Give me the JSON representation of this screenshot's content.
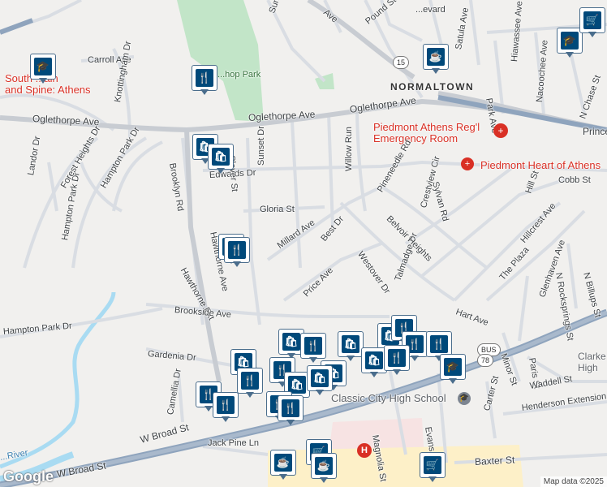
{
  "colors": {
    "water": "#a9dbf2",
    "park": "#c2e5c8",
    "highway": "#8fa4bd",
    "road": "#ffffff",
    "minor_road": "#d9dde3",
    "pin_border": "#4a6d8c",
    "pin_fill": "#00497a",
    "hospital_red": "#d93025"
  },
  "labels": {
    "oglethorpe_1": "Oglethorpe Ave",
    "oglethorpe_2": "Oglethorpe Ave",
    "normaltown": "NORMALTOWN",
    "hospital": "Piedmont Athens Reg'l\nEmergency Room",
    "heart": "Piedmont Heart of Athens",
    "classic_city": "Classic City High School",
    "south_mtn": "South ...ain\nand Spine: Athens",
    "park": "...hop Park",
    "w_broad_1": "W Broad St",
    "w_broad_2": "W Broad St",
    "edwards": "Edwards Dr",
    "gloria": "Gloria St",
    "millard": "Millard Ave",
    "best": "Best Dr",
    "price": "Price Ave",
    "westover": "Westover Dr",
    "talmadge": "Talmadge Dr",
    "belvoir": "Belvoir Heights",
    "pineneedle": "Pineneedle Rd",
    "crestview": "Crestview Cir",
    "sylvan": "Sylvan Rd",
    "willow": "Willow Run",
    "sunset": "Sunset Dr",
    "clover": "Clover St",
    "brooklyn": "Brooklyn Rd",
    "hawthorne_ave": "Hawthorne Ave",
    "hawthorne_ext": "Hawthorne Ext",
    "brookside": "Brookside Ave",
    "hampton_park_1": "Hampton Park Dr",
    "hampton_park_2": "Hampton Park Dr",
    "hampton_park_3": "Hampton Park Dr",
    "forest_heights": "Forest Heights Dr",
    "landor": "Landor Dr",
    "carroll": "Carroll Ave",
    "knottingham": "Knottingham Dr",
    "gardenia": "Gardenia Dr",
    "camellia": "Camellia Dr",
    "jack_pine": "Jack Pine Ln",
    "hart": "Hart Ave",
    "magnolia": "Magnolia St",
    "evans": "Evans St",
    "baxter": "Baxter St",
    "minor": "Minor St",
    "paris": "Paris St",
    "waddell": "Waddell St",
    "henderson": "Henderson Extension",
    "carter": "Carter St",
    "the_plaza": "The Plaza",
    "glenhaven": "Glenhaven Ave",
    "n_rocksprings": "N Rocksprings St",
    "n_billups": "N Billups St",
    "hillcrest": "Hillcrest Ave",
    "hill": "Hill St",
    "cobb": "Cobb St",
    "prince": "Prince...",
    "n_chase": "N Chase St",
    "nacoochee": "Nacoochee Ave",
    "park_ave": "Park Ave",
    "hiawassee": "Hiawassee Ave",
    "satula": "Satula Ave",
    "pound": "Pound St",
    "boulevard": "...evard",
    "sunset_top": "Sunset...",
    "ave_top": "Ave",
    "clarke": "Clarke\nHigh",
    "lake_river": "...River"
  },
  "shields": {
    "us15": "15",
    "us78": "78",
    "bus": "BUS"
  },
  "pins": [
    {
      "kind": "school",
      "icon": "graduation-cap-icon"
    },
    {
      "kind": "restaurant",
      "icon": "fork-knife-icon"
    },
    {
      "kind": "shopping",
      "icon": "shopping-bag-icon"
    },
    {
      "kind": "shopping",
      "icon": "shopping-bag-icon"
    },
    {
      "kind": "restaurant",
      "icon": "fork-knife-icon"
    },
    {
      "kind": "cafe",
      "icon": "coffee-cup-icon"
    },
    {
      "kind": "school",
      "icon": "graduation-cap-icon"
    },
    {
      "kind": "grocery",
      "icon": "shopping-cart-icon"
    },
    {
      "kind": "school",
      "icon": "graduation-cap-icon"
    },
    {
      "kind": "cafe",
      "icon": "coffee-cup-icon"
    },
    {
      "kind": "cafe",
      "icon": "coffee-cup-icon"
    },
    {
      "kind": "grocery",
      "icon": "shopping-cart-icon"
    },
    {
      "kind": "grocery",
      "icon": "shopping-cart-icon"
    }
  ],
  "google_logo": "Google",
  "attribution": "Map data ©2025"
}
